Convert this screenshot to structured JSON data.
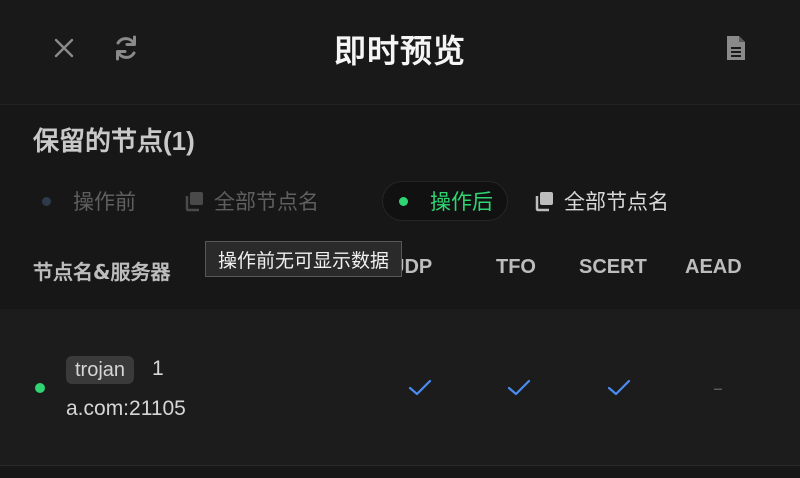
{
  "header": {
    "title": "即时预览",
    "icons": [
      "close-icon",
      "refresh-icon",
      "document-icon"
    ]
  },
  "section": {
    "title": "保留的节点",
    "count": "(1)"
  },
  "tabs": {
    "before": {
      "label": "操作前",
      "names_label": "全部节点名"
    },
    "after": {
      "label": "操作后",
      "names_label": "全部节点名"
    }
  },
  "tooltip": {
    "text": "操作前无可显示数据"
  },
  "table": {
    "columns": [
      "节点名&服务器",
      "UDP",
      "TFO",
      "SCERT",
      "AEAD"
    ],
    "rows": [
      {
        "type": "trojan",
        "name": "1",
        "server": "a.com:21105",
        "udp": true,
        "tfo": true,
        "scert": true,
        "aead": "–"
      }
    ]
  },
  "colors": {
    "background": "#171717",
    "accent_green": "#2fd573",
    "check_blue": "#4a8bf0",
    "dim_text": "#5f5f5f"
  }
}
